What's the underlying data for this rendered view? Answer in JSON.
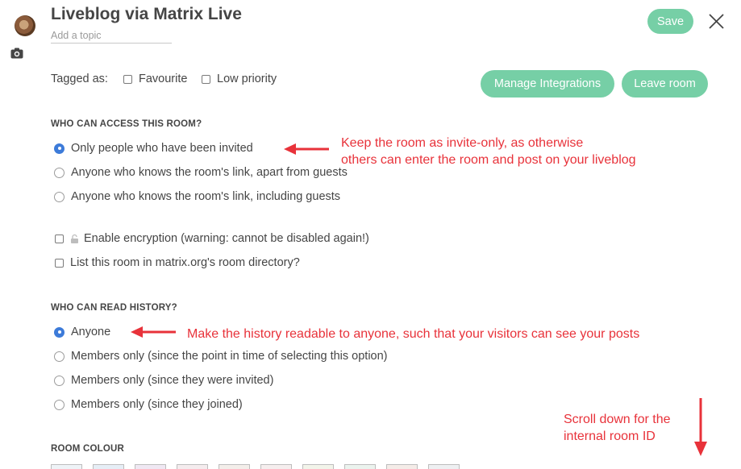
{
  "header": {
    "room_name": "Liveblog via Matrix Live",
    "topic_placeholder": "Add a topic",
    "save_label": "Save"
  },
  "tags": {
    "label": "Tagged as:",
    "favourite": "Favourite",
    "low_priority": "Low priority"
  },
  "actions": {
    "manage_integrations": "Manage Integrations",
    "leave_room": "Leave room"
  },
  "access": {
    "heading": "WHO CAN ACCESS THIS ROOM?",
    "options": [
      "Only people who have been invited",
      "Anyone who knows the room's link, apart from guests",
      "Anyone who knows the room's link, including guests"
    ],
    "selected": 0
  },
  "settings": {
    "encryption": "Enable encryption (warning: cannot be disabled again!)",
    "directory": "List this room in matrix.org's room directory?"
  },
  "history": {
    "heading": "WHO CAN READ HISTORY?",
    "options": [
      "Anyone",
      "Members only (since the point in time of selecting this option)",
      "Members only (since they were invited)",
      "Members only (since they joined)"
    ],
    "selected": 0
  },
  "colour": {
    "heading": "ROOM COLOUR",
    "swatches": [
      "#eef3f7",
      "#e6eef6",
      "#efe8f3",
      "#f4ecee",
      "#f3eeea",
      "#f5eeee",
      "#f2f4ea",
      "#ebf3ee",
      "#f4ece8",
      "#eef0f2"
    ]
  },
  "annotations": {
    "access_line1": "Keep the room as invite-only, as otherwise",
    "access_line2": "others can enter the room and post on your liveblog",
    "history": "Make the history readable to anyone, such that your visitors can see your posts",
    "scroll_line1": "Scroll down for the",
    "scroll_line2": "internal room ID"
  },
  "colors": {
    "accent": "#76cfa6",
    "radio_selected": "#3d7bd9",
    "annotation": "#e8323a"
  }
}
